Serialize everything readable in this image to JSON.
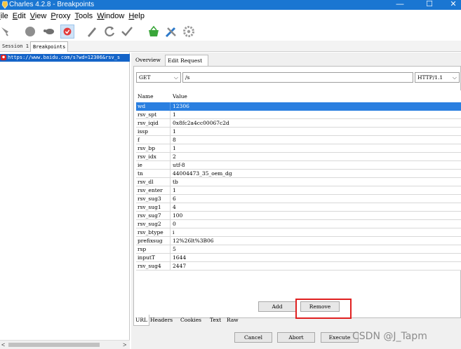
{
  "window": {
    "title": "Charles 4.2.8 - Breakpoints",
    "controls": {
      "minimize": "—",
      "maximize": "☐",
      "close": "✕"
    }
  },
  "menubar": {
    "items": [
      {
        "label": "File",
        "mnemonic": "F"
      },
      {
        "label": "Edit",
        "mnemonic": "E"
      },
      {
        "label": "View",
        "mnemonic": "V"
      },
      {
        "label": "Proxy",
        "mnemonic": "P"
      },
      {
        "label": "Tools",
        "mnemonic": "T"
      },
      {
        "label": "Window",
        "mnemonic": "W"
      },
      {
        "label": "Help",
        "mnemonic": "H"
      }
    ]
  },
  "toolbar": {
    "icons": [
      "broom-icon",
      "record-icon",
      "throttle-turtle-icon",
      "breakpoint-icon",
      "compose-pen-icon",
      "refresh-icon",
      "validate-check-icon",
      "basket-icon",
      "tools-icon",
      "settings-gear-icon"
    ]
  },
  "session_tabs": [
    "Session 1 *",
    "Breakpoints"
  ],
  "left": {
    "tree_item": "https://www.baidu.com/s?wd=12306&rsv_s",
    "scroll_left": "<",
    "scroll_right": ">"
  },
  "tabs": {
    "overview": "Overview",
    "edit_request": "Edit Request"
  },
  "request": {
    "method": "GET",
    "path": "/s",
    "protocol": "HTTP/1.1"
  },
  "params": {
    "headers": {
      "name": "Name",
      "value": "Value"
    },
    "rows": [
      {
        "name": "wd",
        "value": "12306"
      },
      {
        "name": "rsv_spt",
        "value": "1"
      },
      {
        "name": "rsv_iqid",
        "value": "0x8fc2a4cc00067c2d"
      },
      {
        "name": "issp",
        "value": "1"
      },
      {
        "name": "f",
        "value": "8"
      },
      {
        "name": "rsv_bp",
        "value": "1"
      },
      {
        "name": "rsv_idx",
        "value": "2"
      },
      {
        "name": "ie",
        "value": "utf-8"
      },
      {
        "name": "tn",
        "value": "44004473_35_oem_dg"
      },
      {
        "name": "rsv_dl",
        "value": "tb"
      },
      {
        "name": "rsv_enter",
        "value": "1"
      },
      {
        "name": "rsv_sug3",
        "value": "6"
      },
      {
        "name": "rsv_sug1",
        "value": "4"
      },
      {
        "name": "rsv_sug7",
        "value": "100"
      },
      {
        "name": "rsv_sug2",
        "value": "0"
      },
      {
        "name": "rsv_btype",
        "value": "i"
      },
      {
        "name": "prefixsug",
        "value": "12%26lt%3B06"
      },
      {
        "name": "rsp",
        "value": "5"
      },
      {
        "name": "inputT",
        "value": "1644"
      },
      {
        "name": "rsv_sug4",
        "value": "2447"
      }
    ],
    "selected_row": 0
  },
  "buttons": {
    "add": "Add",
    "remove": "Remove",
    "cancel": "Cancel",
    "abort": "Abort",
    "execute": "Execute"
  },
  "bottom_tabs": [
    "URL",
    "Headers",
    "Cookies",
    "Text",
    "Raw"
  ],
  "watermark": "CSDN @J_Tapm",
  "colors": {
    "titlebar": "#1a76d2",
    "selection": "#2a7fe0",
    "highlight": "#e02020",
    "breakpoint": "#dd2222"
  }
}
